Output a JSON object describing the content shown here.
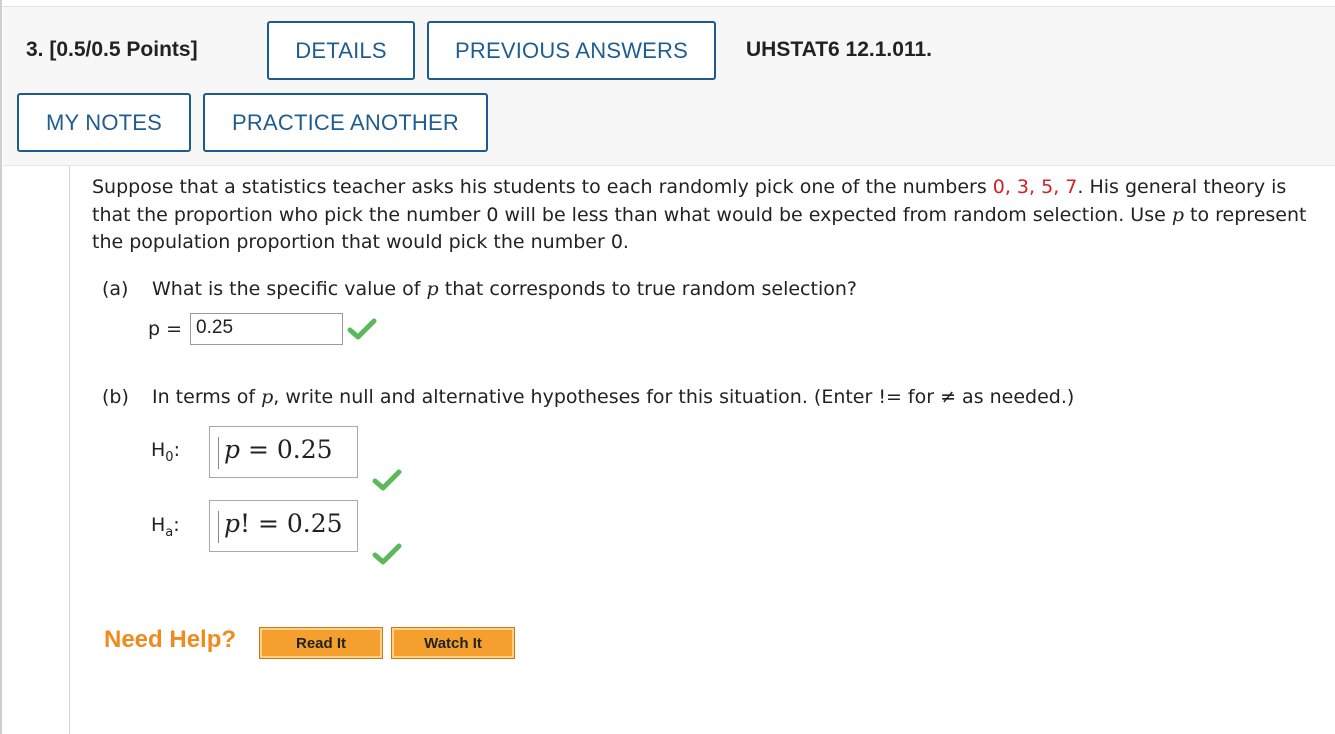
{
  "header": {
    "question_label": "3.  [0.5/0.5 Points]",
    "details_label": "DETAILS",
    "previous_answers_label": "PREVIOUS ANSWERS",
    "reference": "UHSTAT6 12.1.011.",
    "my_notes_label": "MY NOTES",
    "practice_another_label": "PRACTICE ANOTHER"
  },
  "question": {
    "stem_1": "Suppose that a statistics teacher asks his students to each randomly pick one of the numbers ",
    "numbers": "0, 3, 5, 7",
    "stem_2": ". His general theory is that the proportion who pick the number 0 will be less than what would be expected from random selection. Use ",
    "var": "p",
    "stem_3": " to represent the population proportion that would pick the number 0."
  },
  "part_a": {
    "label": "(a)",
    "prompt_1": "What is the specific value of ",
    "var": "p",
    "prompt_2": " that corresponds to true random selection?",
    "answer_label": "p =",
    "answer_value": "0.25",
    "status": "correct"
  },
  "part_b": {
    "label": "(b)",
    "prompt_1": "In terms of ",
    "var": "p",
    "prompt_2": ", write null and alternative hypotheses for this situation. (Enter != for ≠ as needed.)",
    "h0_label": "H",
    "h0_sub": "0",
    "h0_colon": ":",
    "h0_var": "p",
    "h0_rest": " = 0.25",
    "ha_label": "H",
    "ha_sub": "a",
    "ha_colon": ":",
    "ha_var": "p",
    "ha_rest": "! = 0.25",
    "status": "correct"
  },
  "help": {
    "label": "Need Help?",
    "read_it": "Read It",
    "watch_it": "Watch It"
  },
  "colors": {
    "accent_blue": "#1f5d91",
    "highlight_red": "#d42020",
    "help_orange": "#f08a1c",
    "check_green": "#5cb85c"
  }
}
